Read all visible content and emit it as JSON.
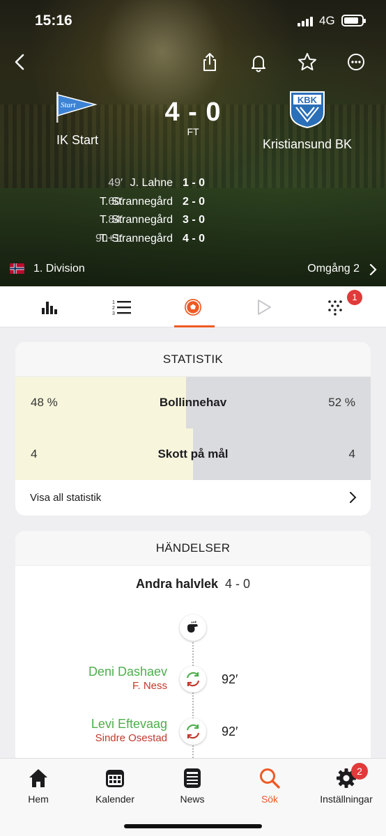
{
  "status_bar": {
    "time": "15:16",
    "network": "4G"
  },
  "header": {
    "home_team": "IK Start",
    "home_logo_text": "Start",
    "away_team": "Kristiansund BK",
    "away_logo_text": "KBK",
    "score": "4 - 0",
    "status": "FT",
    "goals": [
      {
        "minute": "49′",
        "scorer": "J. Lahne",
        "score": "1 - 0"
      },
      {
        "minute": "60′",
        "scorer": "T. Strannegård",
        "score": "2 - 0"
      },
      {
        "minute": "84′",
        "scorer": "T. Strannegård",
        "score": "3 - 0"
      },
      {
        "minute": "90+1′",
        "scorer": "T. Strannegård",
        "score": "4 - 0"
      }
    ],
    "league": "1. Division",
    "round": "Omgång 2"
  },
  "tabs": [
    {
      "icon": "bar-chart-icon"
    },
    {
      "icon": "numbered-list-icon"
    },
    {
      "icon": "football-icon",
      "active": true
    },
    {
      "icon": "play-icon"
    },
    {
      "icon": "lineup-icon",
      "badge": "1"
    }
  ],
  "stats": {
    "title": "STATISTIK",
    "rows": [
      {
        "home": "48 %",
        "label": "Bollinnehav",
        "away": "52 %",
        "home_share": 0.48
      },
      {
        "home": "4",
        "label": "Skott på mål",
        "away": "4",
        "home_share": 0.5
      }
    ],
    "show_all": "Visa all statistik"
  },
  "events": {
    "title": "HÄNDELSER",
    "period": "Andra halvlek",
    "period_score": "4 - 0",
    "subs": [
      {
        "player_in": "Deni Dashaev",
        "player_out": "F. Ness",
        "minute": "92′"
      },
      {
        "player_in": "Levi Eftevaag",
        "player_out": "Sindre Osestad",
        "minute": "92′"
      }
    ]
  },
  "bottom_nav": [
    {
      "label": "Hem",
      "icon": "home-icon"
    },
    {
      "label": "Kalender",
      "icon": "calendar-icon"
    },
    {
      "label": "News",
      "icon": "news-icon"
    },
    {
      "label": "Sök",
      "icon": "search-icon",
      "active": true
    },
    {
      "label": "Inställningar",
      "icon": "settings-icon",
      "badge": "2"
    }
  ],
  "colors": {
    "accent": "#ee5a24",
    "sub_in": "#4cae4c",
    "sub_out": "#c0392b",
    "badge": "#e03a3a"
  }
}
